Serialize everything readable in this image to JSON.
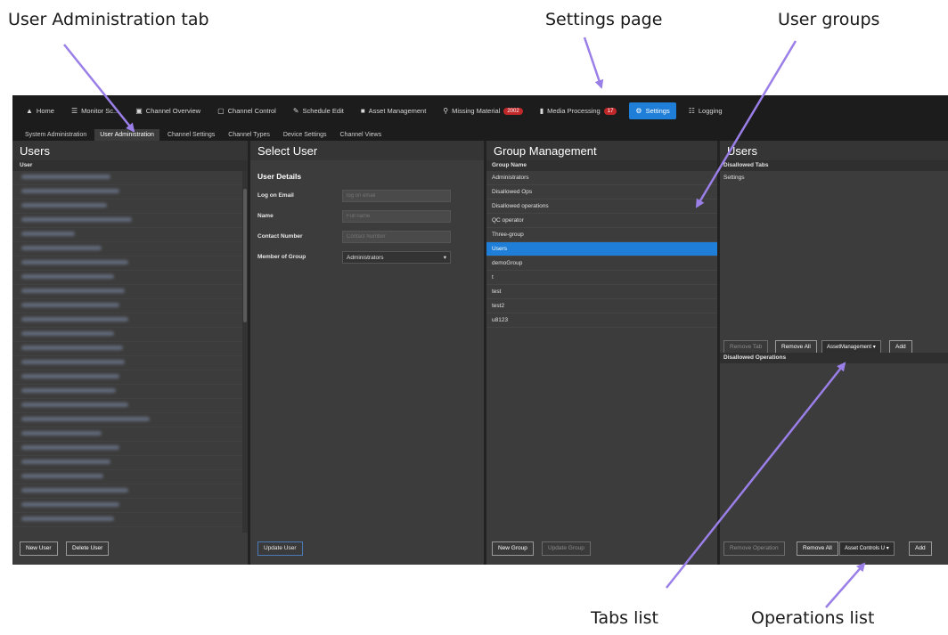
{
  "callouts": {
    "user_admin_tab": "User Administration tab",
    "settings_page": "Settings page",
    "user_groups": "User groups",
    "tabs_list": "Tabs list",
    "operations_list": "Operations list"
  },
  "topnav": {
    "items": [
      {
        "icon": "home-icon",
        "label": "Home"
      },
      {
        "icon": "grid-icon",
        "label": "Monitor Sc..."
      },
      {
        "icon": "monitor-icon",
        "label": "Channel Overview"
      },
      {
        "icon": "monitor-icon",
        "label": "Channel Control"
      },
      {
        "icon": "edit-icon",
        "label": "Schedule Edit"
      },
      {
        "icon": "folder-icon",
        "label": "Asset Management"
      },
      {
        "icon": "search-icon",
        "label": "Missing Material",
        "badge": "2002"
      },
      {
        "icon": "film-icon",
        "label": "Media Processing",
        "badge": "17"
      },
      {
        "icon": "gear-icon",
        "label": "Settings",
        "active": true
      },
      {
        "icon": "list-icon",
        "label": "Logging"
      }
    ]
  },
  "subtabs": [
    "System Administration",
    "User Administration",
    "Channel Settings",
    "Channel Types",
    "Device Settings",
    "Channel Views"
  ],
  "subtabs_active": "User Administration",
  "users_panel": {
    "title": "Users",
    "column_header": "User",
    "new_user": "New User",
    "delete_user": "Delete User"
  },
  "select_user": {
    "title": "Select User",
    "details_title": "User Details",
    "logon_label": "Log on Email",
    "logon_placeholder": "log on email",
    "name_label": "Name",
    "name_placeholder": "Full name",
    "contact_label": "Contact Number",
    "contact_placeholder": "Contact Number",
    "group_label": "Member of Group",
    "group_value": "Administrators",
    "update_user": "Update User"
  },
  "group_management": {
    "title": "Group Management",
    "column_header": "Group Name",
    "groups": [
      "Administrators",
      "Disallowed Ops",
      "Disallowed operations",
      "QC operator",
      "Three-group",
      "Users",
      "demoGroup",
      "t",
      "test",
      "test2",
      "u8123"
    ],
    "selected_group": "Users",
    "new_group": "New Group",
    "update_group": "Update Group"
  },
  "right_panel": {
    "title": "Users",
    "tabs_header": "Disallowed Tabs",
    "tabs": [
      "Settings"
    ],
    "remove_tab": "Remove Tab",
    "remove_all_tabs": "Remove All",
    "tab_select_value": "AssetManagement",
    "add_tab": "Add",
    "ops_header": "Disallowed Operations",
    "remove_operation": "Remove Operation",
    "remove_all_ops": "Remove All",
    "op_select_value": "Asset Controls U",
    "add_op": "Add"
  },
  "blurred_user_count": 25
}
